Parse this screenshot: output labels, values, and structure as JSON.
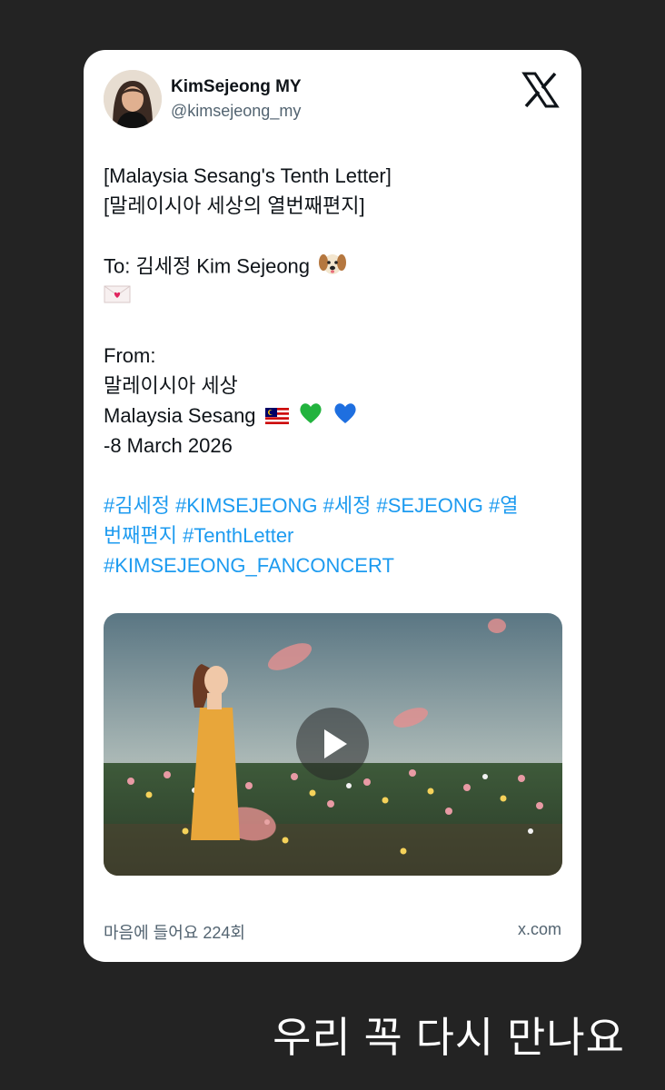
{
  "tweet": {
    "display_name": "KimSejeong MY",
    "handle": "@kimsejeong_my",
    "text_lines": [
      "[Malaysia Sesang's Tenth Letter]",
      "[말레이시아 세상의 열번째편지]",
      "To: 김세정 Kim Sejeong",
      "From:",
      "말레이시아 세상",
      "Malaysia Sesang",
      "-8 March 2026"
    ],
    "hashtag_lines": [
      "#김세정 #KIMSEJEONG #세정 #SEJEONG #열",
      "번째편지 #TenthLetter",
      "#KIMSEJEONG_FANCONCERT"
    ],
    "emojis": {
      "after_to_line": "dog-face-emoji",
      "letter_line": "love-letter-emoji",
      "after_sesang": [
        "malaysia-flag-emoji",
        "green-heart-emoji",
        "blue-heart-emoji"
      ]
    },
    "likes_text": "마음에 들어요 224회",
    "domain": "x.com"
  },
  "caption": "우리 꼭 다시 만나요",
  "colors": {
    "page_background": "#232323",
    "card_background": "#ffffff",
    "text_primary": "#0f1419",
    "text_secondary": "#536471",
    "hashtag": "#1d9bf0"
  }
}
